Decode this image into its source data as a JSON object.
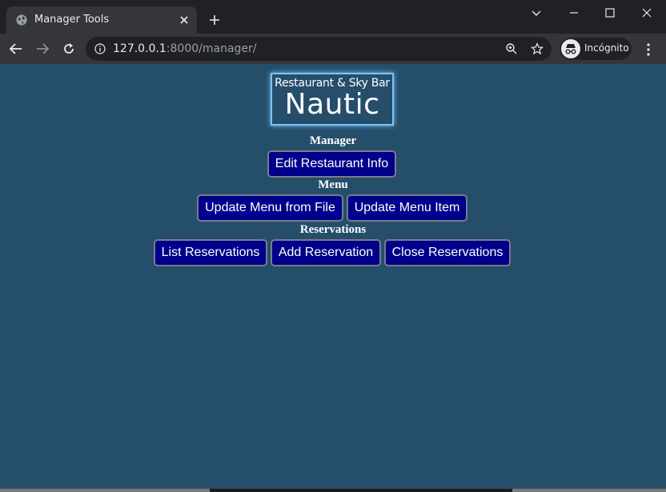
{
  "browser": {
    "tab_title": "Manager Tools",
    "url_host": "127.0.0.1",
    "url_rest": ":8000/manager/",
    "profile_label": "Incógnito"
  },
  "logo": {
    "top_text": "Restaurant & Sky Bar",
    "main_text": "Nautic"
  },
  "sections": {
    "manager": {
      "title": "Manager",
      "buttons": [
        "Edit Restaurant Info"
      ]
    },
    "menu": {
      "title": "Menu",
      "buttons": [
        "Update Menu from File",
        "Update Menu Item"
      ]
    },
    "reservations": {
      "title": "Reservations",
      "buttons": [
        "List Reservations",
        "Add Reservation",
        "Close Reservations"
      ]
    }
  },
  "colors": {
    "page_background": "#254e6b",
    "button_background": "#00008b",
    "logo_border": "#7cc4f5"
  }
}
